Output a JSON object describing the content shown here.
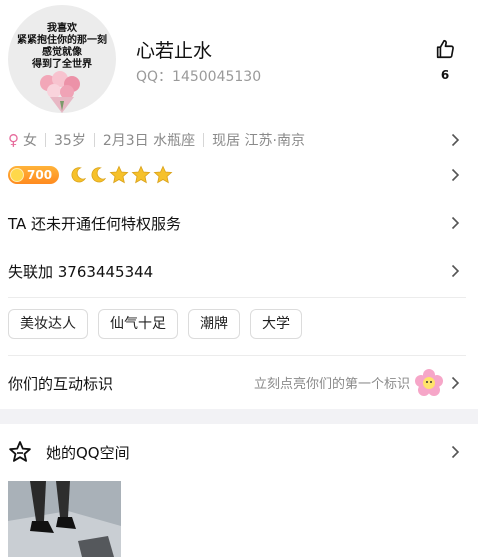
{
  "profile": {
    "avatar_quote_lines": [
      "我喜欢",
      "紧紧抱住你的那一刻",
      "感觉就像",
      "得到了全世界"
    ],
    "name": "心若止水",
    "qq": "QQ：1450045130",
    "like_count": "6"
  },
  "info": {
    "gender_symbol": "♀",
    "gender": "女",
    "age": "35岁",
    "birthday": "2月3日 水瓶座",
    "location": "现居 江苏·南京"
  },
  "level": {
    "score": "700",
    "icons": [
      "moon-icon",
      "moon-icon",
      "star-icon",
      "star-icon",
      "star-icon"
    ]
  },
  "rows": {
    "privilege": "TA 还未开通任何特权服务",
    "lost_contact": "失联加 3763445344"
  },
  "tags": [
    "美妆达人",
    "仙气十足",
    "潮牌",
    "大学"
  ],
  "interaction": {
    "title": "你们的互动标识",
    "hint": "立刻点亮你们的第一个标识"
  },
  "zone": {
    "title": "她的QQ空间"
  },
  "colors": {
    "accent_pink": "#e66b9c",
    "level_orange": "#ff9a26",
    "icon_gold": "#f6c12b",
    "gray_text": "#8a8a8a"
  }
}
